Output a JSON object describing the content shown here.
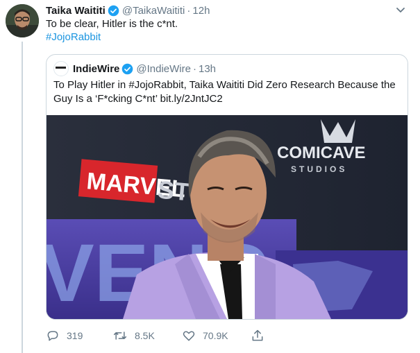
{
  "tweet": {
    "author_name": "Taika Waititi",
    "author_handle": "@TaikaWaititi",
    "separator": "·",
    "time": "12h",
    "text": "To be clear, Hitler is the c*nt.",
    "hashtag": "#JojoRabbit"
  },
  "quote": {
    "author_name": "IndieWire",
    "author_handle": "@IndieWire",
    "separator": "·",
    "time": "13h",
    "text": "To Play Hitler in #JojoRabbit, Taika Waititi Did Zero Research Because the Guy Is a ‘F*cking C*nt’ bit.ly/2JntJC2",
    "image_signage": {
      "marvel": "MARVEL",
      "studios": "STUDI",
      "comicave": "COMICAVE",
      "comicave_sub": "STUDIOS",
      "avengers": "VENG"
    }
  },
  "actions": {
    "replies": "319",
    "retweets": "8.5K",
    "likes": "70.9K"
  },
  "colors": {
    "link": "#1b95e0",
    "muted": "#657786",
    "verified": "#1da1f2",
    "suit": "#b7a1e3"
  },
  "icons": {
    "reply": "reply-icon",
    "retweet": "retweet-icon",
    "like": "heart-icon",
    "share": "share-icon",
    "verified": "verified-badge-icon",
    "menu": "chevron-down-icon"
  }
}
